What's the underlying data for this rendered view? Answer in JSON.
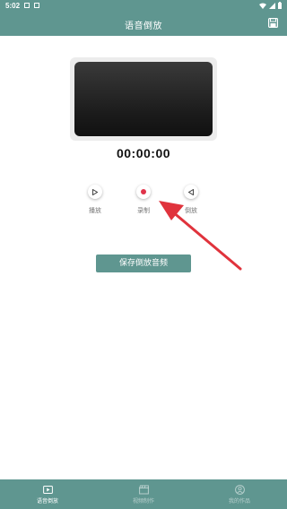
{
  "status_bar": {
    "time": "5:02"
  },
  "header": {
    "title": "语音倒放"
  },
  "player": {
    "timer": "00:00:00"
  },
  "controls": {
    "play_label": "播放",
    "record_label": "录制",
    "reverse_label": "倒放"
  },
  "actions": {
    "save_audio_label": "保存倒放音频"
  },
  "bottom_nav": {
    "items": [
      {
        "label": "语音倒放",
        "icon": "play-square-icon",
        "active": true
      },
      {
        "label": "视频制作",
        "icon": "clapper-icon",
        "active": false
      },
      {
        "label": "我的作品",
        "icon": "user-circle-icon",
        "active": false
      }
    ]
  },
  "colors": {
    "primary": "#5f9690",
    "record_red": "#e0334a",
    "arrow_red": "#e0333c"
  }
}
